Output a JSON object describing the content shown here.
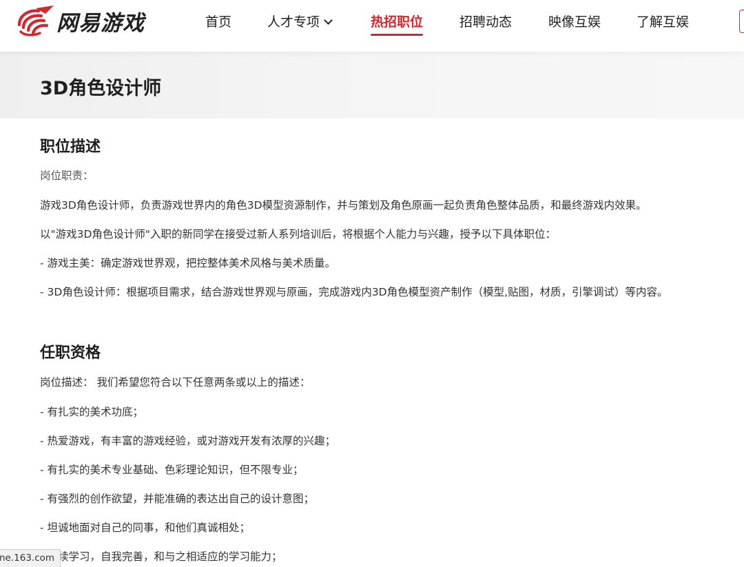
{
  "header": {
    "logo_text": "网易游戏",
    "nav": [
      {
        "label": "首页",
        "active": false
      },
      {
        "label": "人才专项",
        "active": false,
        "has_dropdown": true
      },
      {
        "label": "热招职位",
        "active": true
      },
      {
        "label": "招聘动态",
        "active": false
      },
      {
        "label": "映像互娱",
        "active": false
      },
      {
        "label": "了解互娱",
        "active": false
      }
    ]
  },
  "job": {
    "title": "3D角色设计师"
  },
  "description": {
    "heading": "职位描述",
    "lines": [
      "岗位职责：",
      "游戏3D角色设计师，负责游戏世界内的角色3D模型资源制作，并与策划及角色原画一起负责角色整体品质，和最终游戏内效果。",
      "以\"游戏3D角色设计师\"入职的新同学在接受过新人系列培训后，将根据个人能力与兴趣，授予以下具体职位：",
      "- 游戏主美：确定游戏世界观，把控整体美术风格与美术质量。",
      "- 3D角色设计师：根据项目需求，结合游戏世界观与原画，完成游戏内3D角色模型资产制作（模型,贴图，材质，引擎调试）等内容。"
    ]
  },
  "qualifications": {
    "heading": "任职资格",
    "lines": [
      "岗位描述： 我们希望您符合以下任意两条或以上的描述：",
      "- 有扎实的美术功底；",
      "- 热爱游戏，有丰富的游戏经验，或对游戏开发有浓厚的兴趣；",
      "- 有扎实的美术专业基础、色彩理论知识，但不限专业；",
      "- 有强烈的创作欲望，并能准确的表达出自己的设计意图；",
      "- 坦诚地面对自己的同事，和他们真诚相处；",
      "- 持续学习，自我完善，和与之相适应的学习能力；"
    ]
  },
  "status_bar": {
    "url_text": "ne.163.com"
  },
  "colors": {
    "accent": "#d6252b",
    "text": "#222222",
    "band": "#f3f3f3"
  },
  "icons": {
    "logo": "netease-swirl-logo",
    "dropdown": "chevron-down-icon"
  }
}
